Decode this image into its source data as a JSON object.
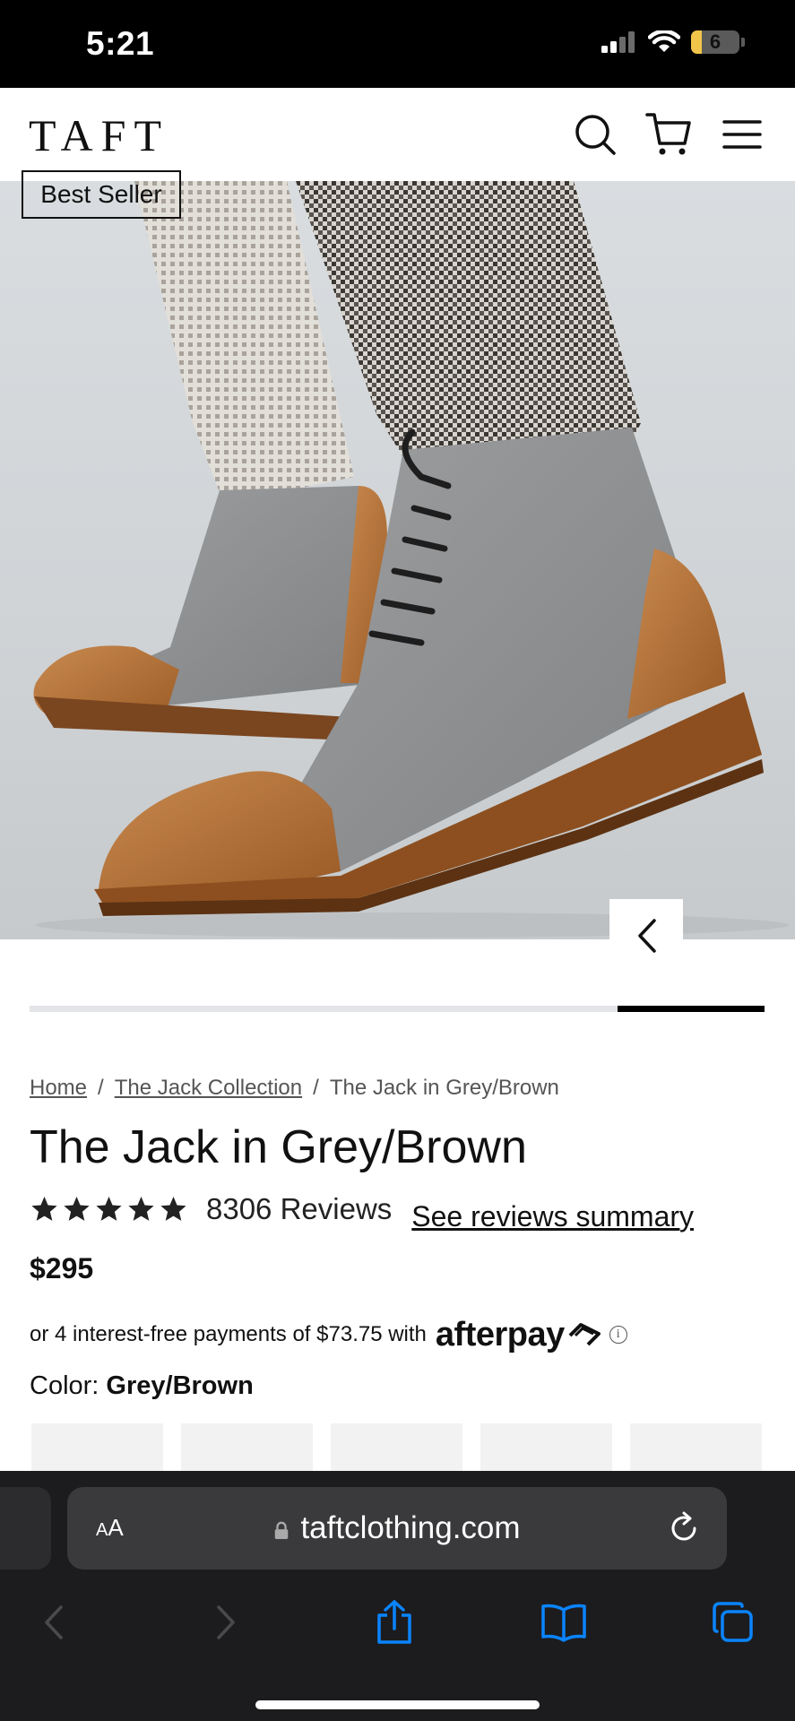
{
  "status_bar": {
    "time": "5:21",
    "battery_level": "6",
    "battery_fraction": 0.06
  },
  "header": {
    "logo": "TAFT",
    "icons": [
      "search-icon",
      "cart-icon",
      "menu-icon"
    ]
  },
  "hero": {
    "badge": "Best Seller",
    "carousel_progress_fraction": 0.2
  },
  "breadcrumb": {
    "items": [
      "Home",
      "The Jack Collection",
      "The Jack in Grey/Brown"
    ],
    "separator": "/"
  },
  "product": {
    "title": "The Jack in Grey/Brown",
    "rating_stars": 5,
    "review_count": "8306 Reviews",
    "reviews_link": "See reviews summary",
    "price": "$295",
    "afterpay_text": "or 4 interest-free payments of $73.75 with",
    "afterpay_brand": "afterpay",
    "info_glyph": "i",
    "color_label": "Color:",
    "color_value": "Grey/Brown"
  },
  "browser": {
    "aa_label_small": "A",
    "aa_label_large": "A",
    "url": "taftclothing.com",
    "toolbar_icons": [
      "back-icon",
      "forward-icon",
      "share-icon",
      "bookmarks-icon",
      "tabs-icon"
    ]
  },
  "colors": {
    "accent": "#000000",
    "boot_leather": "#b8733a",
    "boot_felt": "#8e9092",
    "safari_link": "#0a84ff",
    "toolbar_bg": "#1c1c1e"
  }
}
